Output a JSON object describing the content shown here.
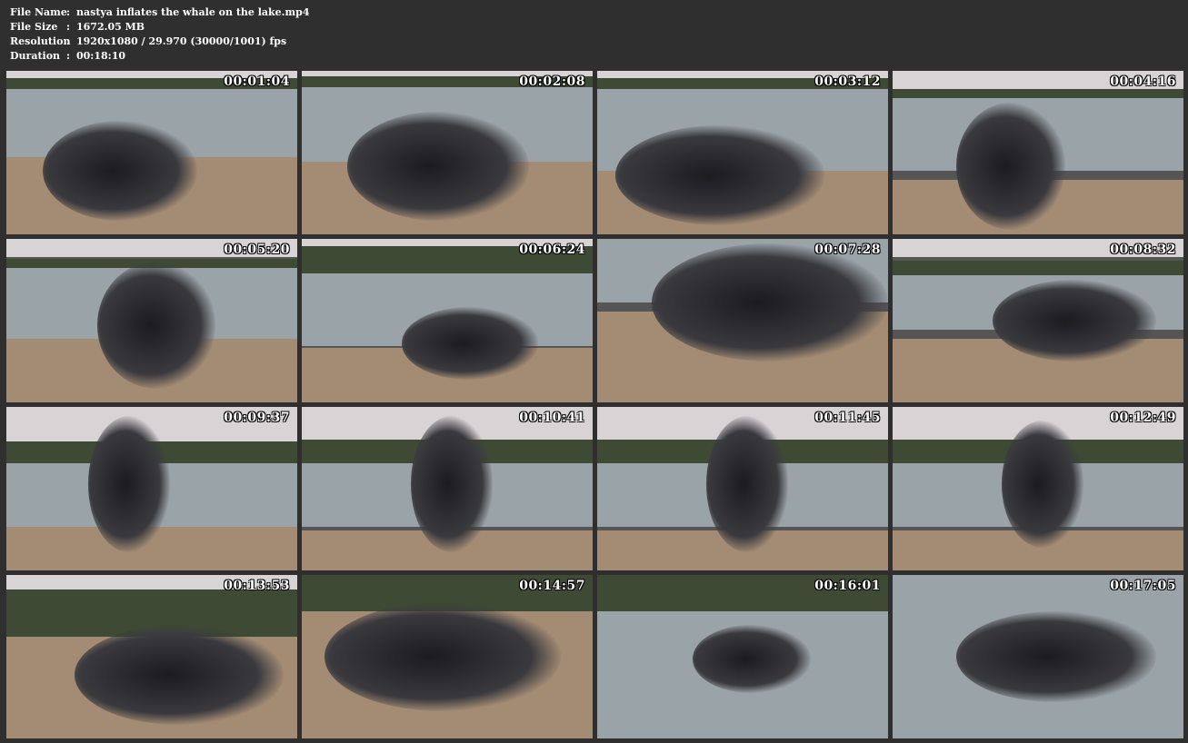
{
  "info": {
    "rows": [
      {
        "key": "File Name",
        "sep": ":",
        "value": "nastya inflates the whale on the lake.mp4"
      },
      {
        "key": "File Size",
        "sep": ":",
        "value": "1672.05 MB"
      },
      {
        "key": "Resolution",
        "sep": ":",
        "value": "1920x1080 / 29.970 (30000/1001) fps"
      },
      {
        "key": "Duration",
        "sep": ":",
        "value": "00:18:10"
      }
    ]
  },
  "thumbnails": [
    {
      "timestamp": "00:01:04"
    },
    {
      "timestamp": "00:02:08"
    },
    {
      "timestamp": "00:03:12"
    },
    {
      "timestamp": "00:04:16"
    },
    {
      "timestamp": "00:05:20"
    },
    {
      "timestamp": "00:06:24"
    },
    {
      "timestamp": "00:07:28"
    },
    {
      "timestamp": "00:08:32"
    },
    {
      "timestamp": "00:09:37"
    },
    {
      "timestamp": "00:10:41"
    },
    {
      "timestamp": "00:11:45"
    },
    {
      "timestamp": "00:12:49"
    },
    {
      "timestamp": "00:13:53"
    },
    {
      "timestamp": "00:14:57"
    },
    {
      "timestamp": "00:16:01"
    },
    {
      "timestamp": "00:17:05"
    }
  ],
  "colors": {
    "background": "#2f2f2f",
    "text": "#ffffff",
    "sky": "#d8d4d6",
    "trees": "#3e4a34",
    "water": "#9aa3a8",
    "sand": "#a48c74",
    "inflatable": "#1c1c1f"
  }
}
